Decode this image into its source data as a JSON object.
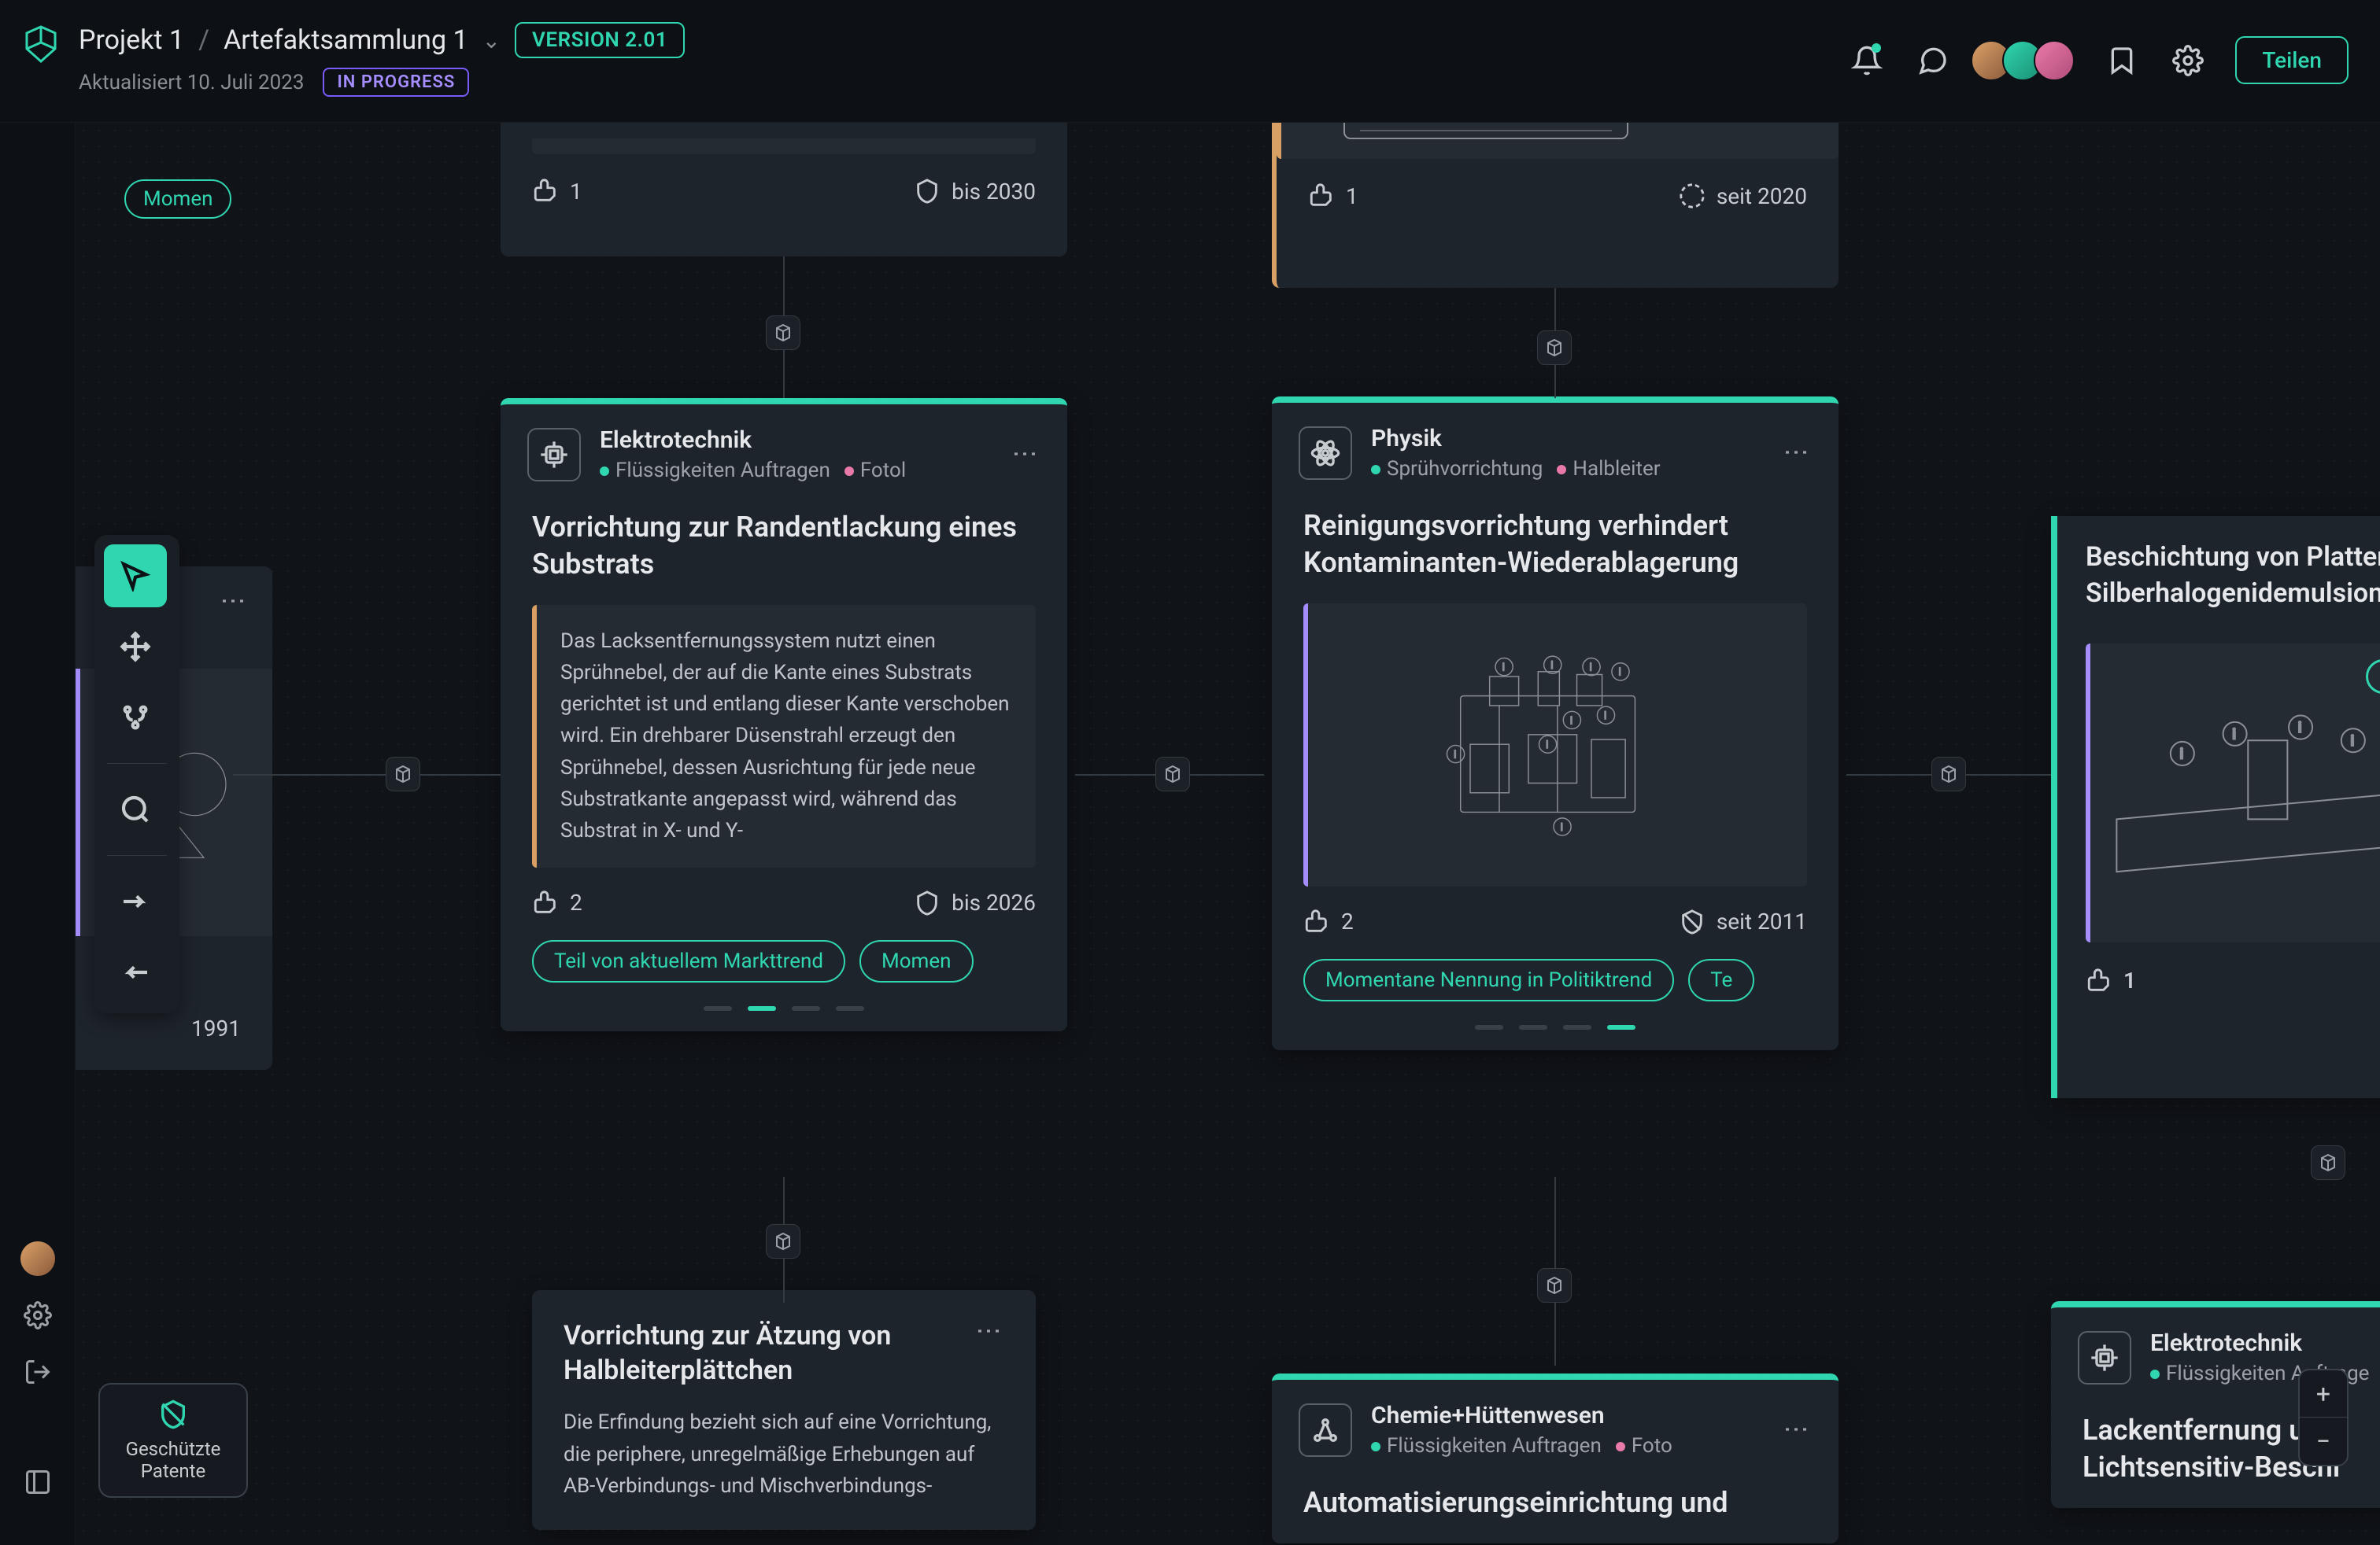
{
  "header": {
    "project": "Projekt 1",
    "collection": "Artefaktsammlung 1",
    "version": "VERSION 2.01",
    "updated": "Aktualisiert 10. Juli 2023",
    "status": "IN PROGRESS",
    "share": "Teilen"
  },
  "partial_top": {
    "pill": "Momen",
    "left_like": "1",
    "left_date": "bis 2030",
    "right_like": "1",
    "right_date": "seit 2020"
  },
  "card_a": {
    "category": "Elektrotechnik",
    "tag1": "Flüssigkeiten Auftragen",
    "tag2": "Fotol",
    "title": "Vorrichtung zur Randentlackung eines Substrats",
    "body": "Das Lacksentfernungssystem nutzt einen Sprühnebel, der auf die Kante eines Substrats gerichtet ist und entlang dieser Kante verschoben wird. Ein drehbarer Düsenstrahl erzeugt den Sprühnebel, dessen Ausrichtung für jede neue Substratkante angepasst wird, während das Substrat in X- und Y-",
    "likes": "2",
    "date": "bis 2026",
    "chip1": "Teil von aktuellem Markttrend",
    "chip2": "Momen"
  },
  "card_b": {
    "category": "Physik",
    "tag1": "Sprühvorrichtung",
    "tag2": "Halbleiter",
    "title": "Reinigungsvorrichtung verhindert Kontaminanten-Wiederablagerung",
    "likes": "2",
    "date": "seit 2011",
    "chip1": "Momentane Nennung in Politiktrend",
    "chip2": "Te"
  },
  "card_c": {
    "title": "Vorrichtung zur Ätzung von Halbleiterplättchen",
    "body": "Die Erfindung bezieht sich auf eine Vorrichtung, die periphere, unregelmäßige Erhebungen auf AB-Verbindungs- und Mischverbindungs-"
  },
  "card_d": {
    "category": "Chemie+Hüttenwesen",
    "tag1": "Flüssigkeiten Auftragen",
    "tag2": "Foto",
    "title": "Automatisierungseinrichtung und"
  },
  "card_e": {
    "title": "Beschichtung von Platten m\nSilberhalogenidemulsion",
    "likes": "1"
  },
  "card_f": {
    "category": "Elektrotechnik",
    "tag1": "Flüssigkeiten Auftrage",
    "title": "Lackentfernung und\nLichtsensitiv-Beschi"
  },
  "float": {
    "date_left": "1991"
  },
  "filter": {
    "label": "Geschützte Patente"
  },
  "tool_menu_label": "..."
}
